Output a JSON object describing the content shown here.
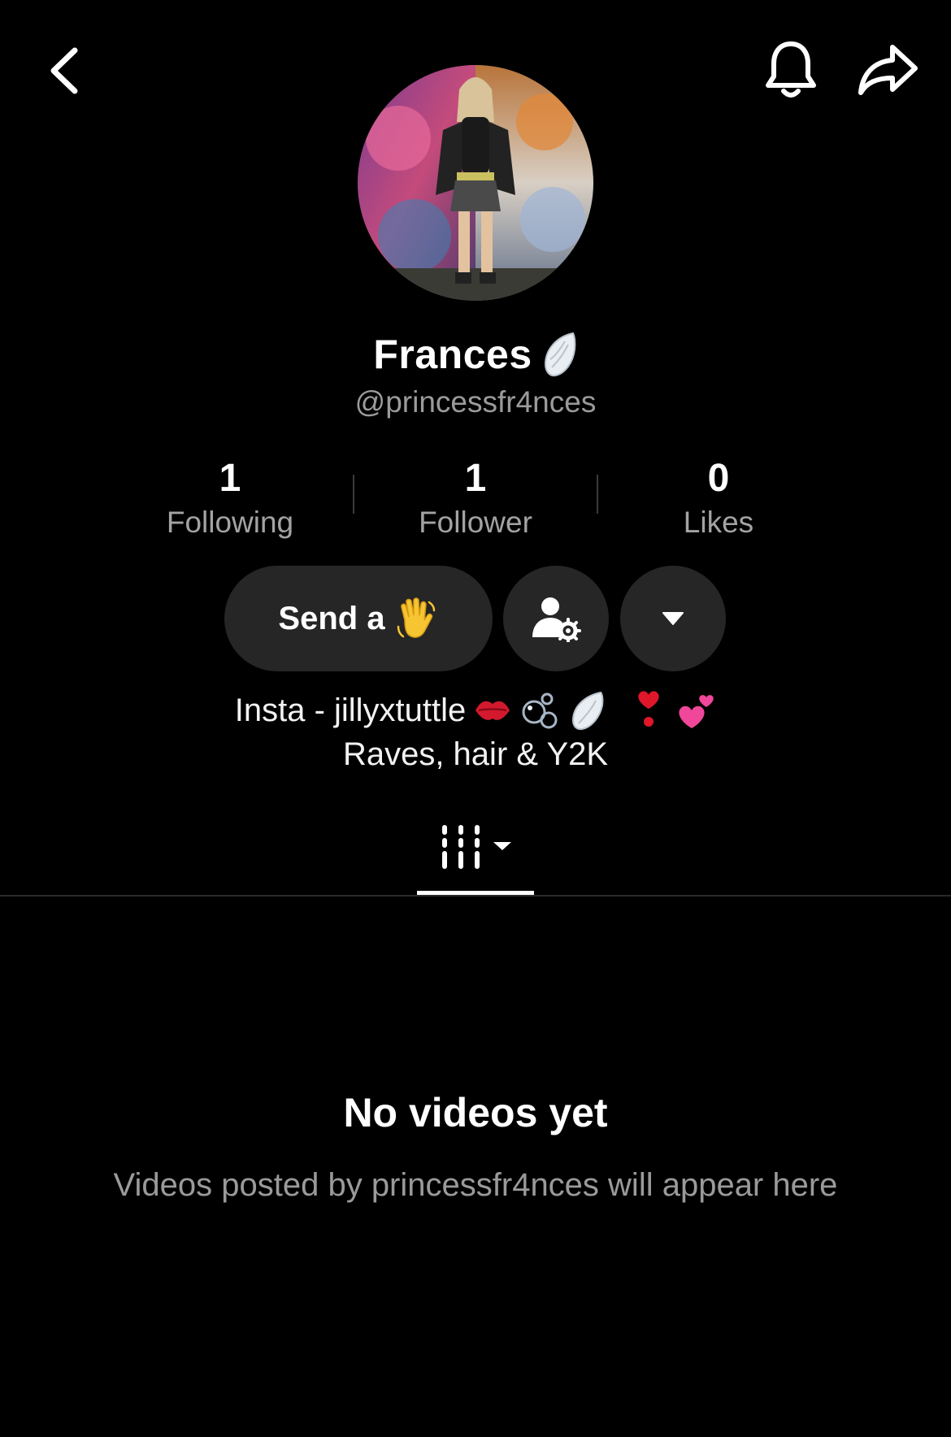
{
  "header": {
    "back_icon": "chevron-left-icon",
    "bell_icon": "bell-icon",
    "share_icon": "share-arrow-icon"
  },
  "profile": {
    "display_name": "Frances",
    "handle": "@princessfr4nces"
  },
  "stats": [
    {
      "value": "1",
      "label": "Following"
    },
    {
      "value": "1",
      "label": "Follower"
    },
    {
      "value": "0",
      "label": "Likes"
    }
  ],
  "actions": {
    "send_label": "Send a",
    "send_emoji_icon": "waving-hand-icon",
    "friend_settings_icon": "person-gear-icon",
    "more_icon": "caret-down-icon"
  },
  "bio": {
    "line1": "Insta - jillyxtuttle",
    "line1_icons": [
      "kiss-mark-icon",
      "bubbles-icon",
      "wing-icon",
      "heart-exclamation-icon",
      "two-hearts-icon"
    ],
    "line2": "Raves, hair & Y2K"
  },
  "tabs": {
    "videos_icon": "grid-lines-icon"
  },
  "empty_state": {
    "title": "No videos yet",
    "subtitle": "Videos posted by princessfr4nces will appear here"
  },
  "colors": {
    "background": "#000000",
    "button_bg": "#262626",
    "secondary_text": "#9b9b9b"
  }
}
